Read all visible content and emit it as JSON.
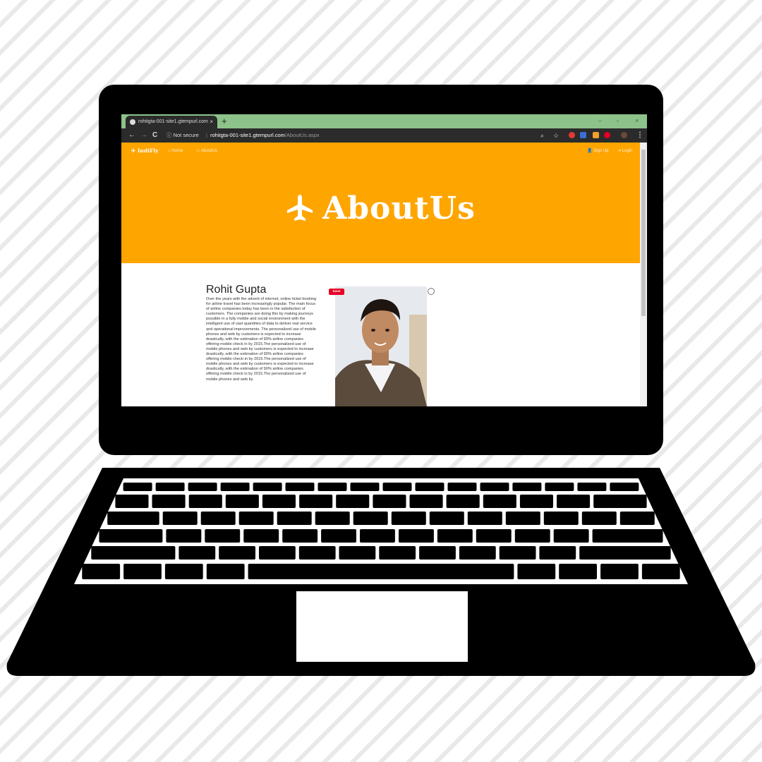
{
  "browser": {
    "tab_title": "rohitgta-001-site1.gtempurl.com",
    "tab_close": "×",
    "new_tab": "+",
    "window_controls": [
      "–",
      "▫",
      "×"
    ],
    "back": "←",
    "forward": "→",
    "reload": "C",
    "security_label": "ⓘ Not secure",
    "url_host": "rohitgta-001-site1.gtempurl.com",
    "url_path": "/AboutUs.aspx"
  },
  "site": {
    "brand": "IndiFly",
    "nav": {
      "home": "Home",
      "about": "AboutUs",
      "signup": "Sign Up",
      "login": "Login"
    },
    "hero_title": "AboutUs",
    "colors": {
      "accent": "#ffa500",
      "save_red": "#e60023"
    }
  },
  "profile": {
    "name": "Rohit Gupta",
    "bio": "Over the years with the advent of internet, online ticket booking for airline travel has been increasingly popular. The main focus of airline companies today has been in the satisfaction of customers. The companies are doing this by making journeys possible in a fully mobile and social environment with the intelligent use of vast quantities of data to deliver real service and operational improvements. The personalized use of mobile phones and web by customers is expected to increase drastically, with the estimation of 90% airline companies offering mobile check in by 2015.The personalized use of mobile phones and web by customers is expected to increase drastically, with the estimation of 90% airline companies offering mobile check-in by 2015.The personalized use of mobile phones and web by customers is expected to increase drastically, with the estimation of 90% airline companies offering mobile check in by 2015.The personalized use of mobile phones and web by",
    "save_label": "Save"
  }
}
